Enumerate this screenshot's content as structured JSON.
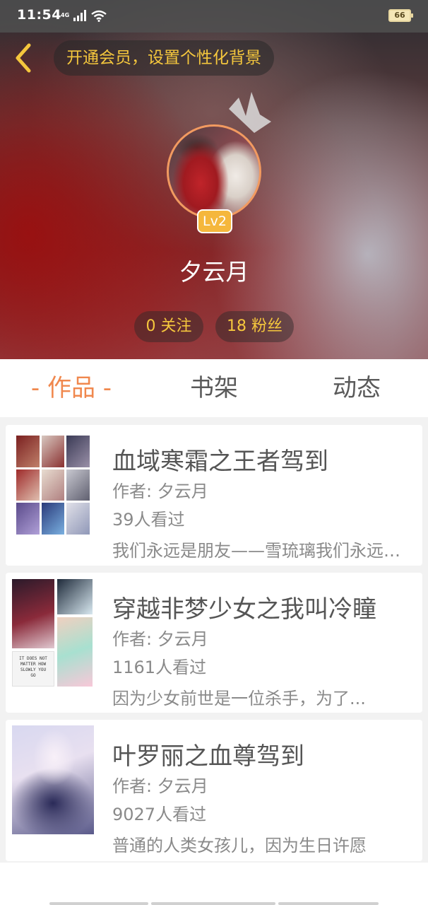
{
  "status_bar": {
    "time": "11:54",
    "network": "4G",
    "battery": "66"
  },
  "header": {
    "vip_prompt": "开通会员，设置个性化背景",
    "username": "夕云月",
    "level": "Lv2",
    "stats": {
      "following": "0 关注",
      "fans": "18 粉丝"
    }
  },
  "tabs": [
    {
      "label": "- 作品 -",
      "active": true
    },
    {
      "label": "书架",
      "active": false
    },
    {
      "label": "动态",
      "active": false
    }
  ],
  "works": [
    {
      "title": "血域寒霜之王者驾到",
      "author": "作者: 夕云月",
      "views": "39人看过",
      "description": "我们永远是朋友——雪琉璃我们永远是朋友"
    },
    {
      "title": "穿越非梦少女之我叫冷瞳",
      "author": "作者: 夕云月",
      "views": "1161人看过",
      "description": "因为少女前世是一位杀手，为了..."
    },
    {
      "title": "叶罗丽之血尊驾到",
      "author": "作者: 夕云月",
      "views": "9027人看过",
      "description": "普通的人类女孩儿，因为生日许愿"
    }
  ],
  "cover_texts": {
    "book2_caption": "IT DOES NOT MATTER HOW SLOWLY YOU GO"
  },
  "colors": {
    "accent": "#f0884e",
    "gold": "#f5c73d",
    "badge": "#f5b73c"
  }
}
